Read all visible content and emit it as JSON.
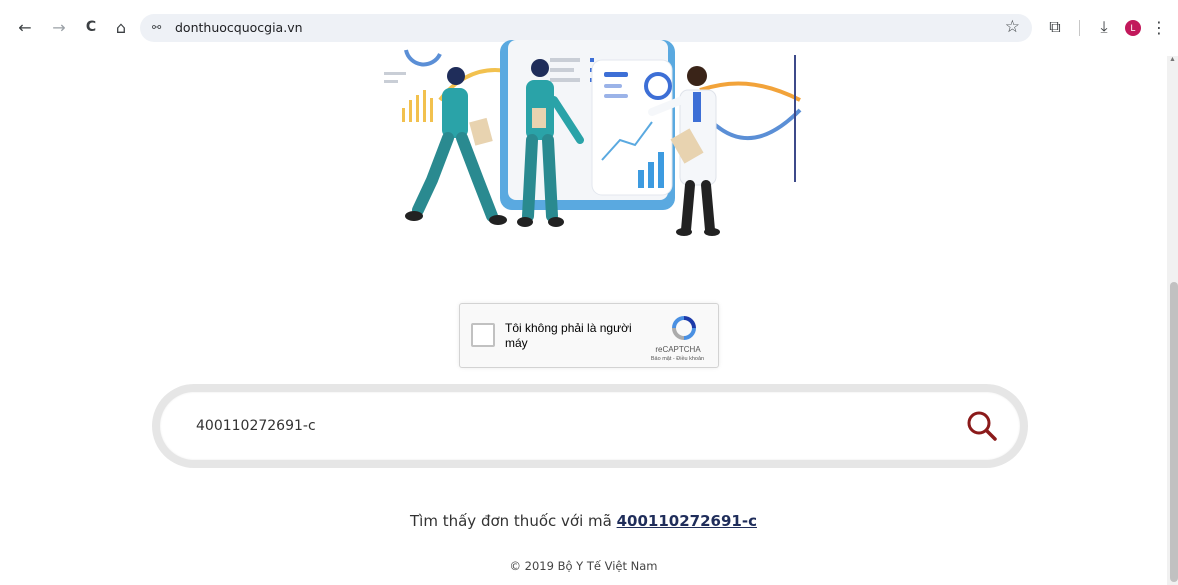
{
  "browser": {
    "url": "donthuocquocgia.vn",
    "back_icon": "←",
    "forward_icon": "→",
    "reload_icon": "C",
    "home_icon": "⌂",
    "site_info_icon": "⚯",
    "bookmark_icon": "☆",
    "extensions_icon": "⧉",
    "download_icon": "⤓",
    "profile_initial": "L",
    "menu_icon": "⋮"
  },
  "recaptcha": {
    "label": "Tôi không phải là người máy",
    "brand": "reCAPTCHA",
    "links": "Bảo mật - Điều khoản"
  },
  "search": {
    "value": "400110272691-c",
    "icon": "search-icon"
  },
  "result": {
    "prefix": "Tìm thấy đơn thuốc với mã",
    "code": "400110272691-c"
  },
  "footer": {
    "text": "© 2019 Bộ Y Tế Việt Nam"
  },
  "colors": {
    "search_icon": "#8b1a1a",
    "result_link": "#1f2d5a",
    "accent_teal": "#2aa3a8",
    "accent_orange": "#f2a33a"
  }
}
